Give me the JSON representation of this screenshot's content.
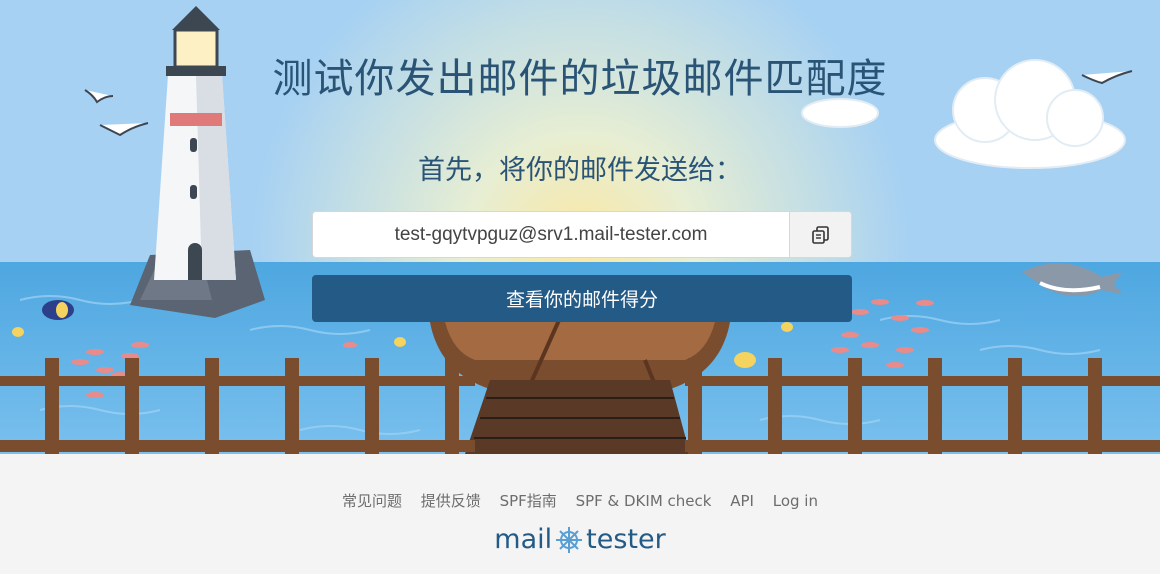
{
  "hero": {
    "title": "测试你发出邮件的垃圾邮件匹配度",
    "subtitle": "首先，将你的邮件发送给：",
    "email_address": "test-gqytvpguz@srv1.mail-tester.com",
    "copy_icon": "copy-icon",
    "check_button_label": "查看你的邮件得分"
  },
  "footer": {
    "links": [
      "常见问题",
      "提供反馈",
      "SPF指南",
      "SPF & DKIM check",
      "API",
      "Log in"
    ],
    "logo_left": "mail",
    "logo_icon": "ship-wheel-icon",
    "logo_right": "tester"
  },
  "colors": {
    "sky": "#9fcdf2",
    "sea": "#5fb0e6",
    "primary": "#235a86",
    "title": "#2a5476"
  }
}
